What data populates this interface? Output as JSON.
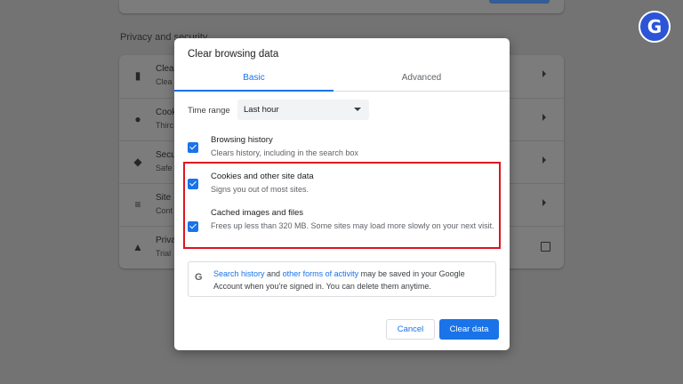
{
  "background": {
    "section_title": "Privacy and security",
    "rows": [
      {
        "icon": "trash-icon",
        "title": "Clea",
        "subtitle": "Clea"
      },
      {
        "icon": "cookie-icon",
        "title": "Cook",
        "subtitle": "Thirc"
      },
      {
        "icon": "shield-icon",
        "title": "Secu",
        "subtitle": "Safe"
      },
      {
        "icon": "sliders-icon",
        "title": "Site",
        "subtitle": "Cont"
      },
      {
        "icon": "flask-icon",
        "title": "Priva",
        "subtitle": "Trial"
      }
    ]
  },
  "logo": {
    "glyph": "G",
    "color": "#2b55d6"
  },
  "dialog": {
    "title": "Clear browsing data",
    "tabs": {
      "basic": "Basic",
      "advanced": "Advanced"
    },
    "time_range": {
      "label": "Time range",
      "value": "Last hour"
    },
    "options": [
      {
        "title": "Browsing history",
        "subtitle": "Clears history, including in the search box",
        "checked": true
      },
      {
        "title": "Cookies and other site data",
        "subtitle": "Signs you out of most sites.",
        "checked": true
      },
      {
        "title": "Cached images and files",
        "subtitle": "Frees up less than 320 MB. Some sites may load more slowly on your next visit.",
        "checked": true
      }
    ],
    "info": {
      "icon": "google-g-icon",
      "link1": "Search history",
      "and": " and ",
      "link2": "other forms of activity",
      "rest": " may be saved in your Google Account when you're signed in. You can delete them anytime."
    },
    "buttons": {
      "cancel": "Cancel",
      "clear": "Clear data"
    }
  },
  "colors": {
    "accent": "#1a73e8",
    "highlight": "#e0141e"
  }
}
